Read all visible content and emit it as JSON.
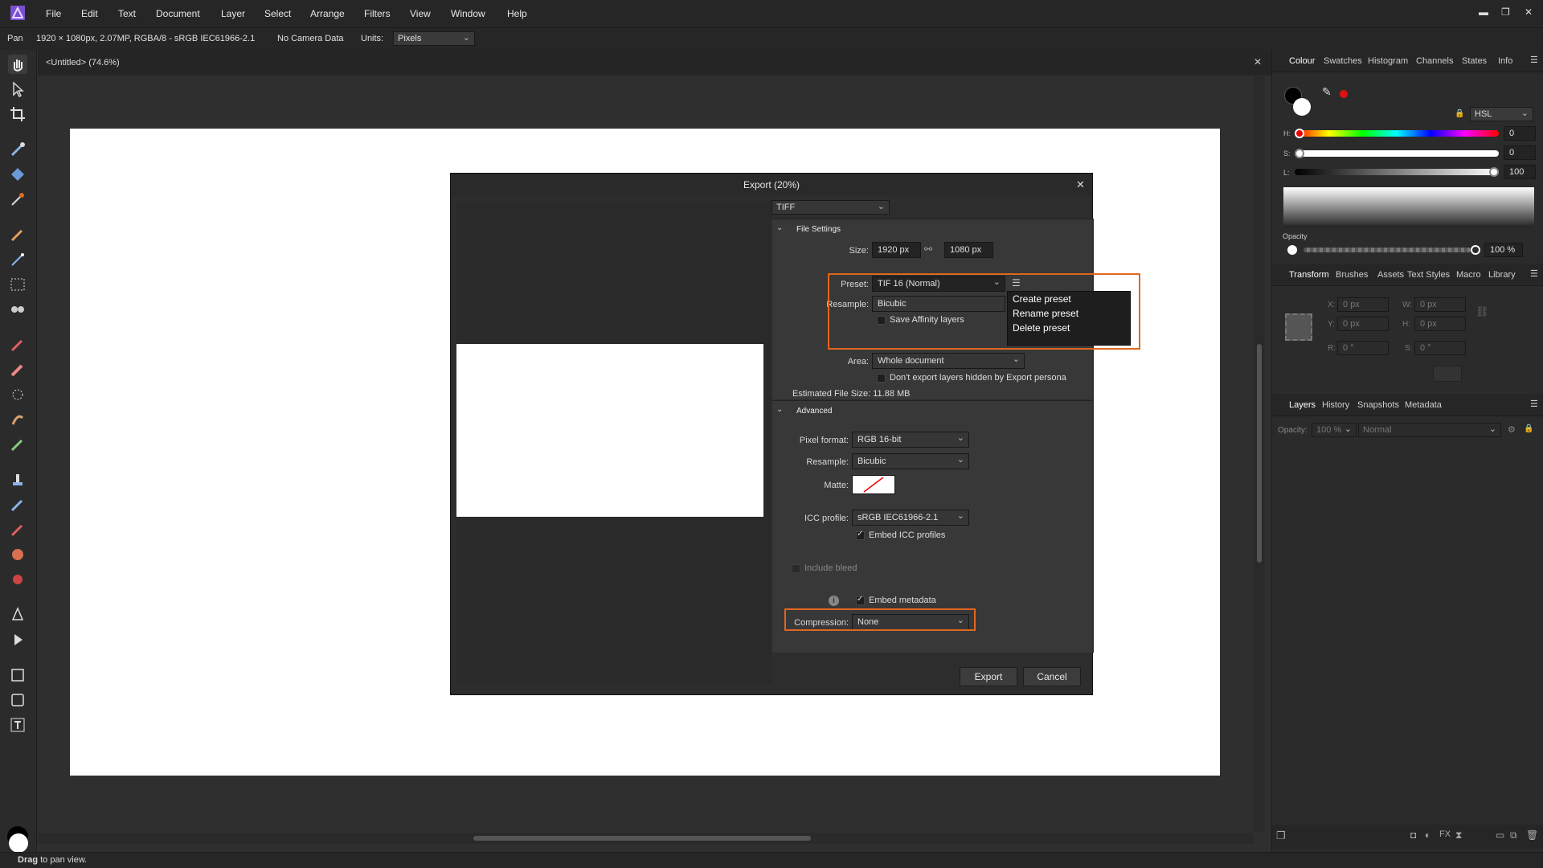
{
  "menubar": {
    "items": [
      "File",
      "Edit",
      "Text",
      "Document",
      "Layer",
      "Select",
      "Arrange",
      "Filters",
      "View",
      "Window",
      "Help"
    ]
  },
  "context": {
    "tool": "Pan",
    "doc_info": "1920 × 1080px, 2.07MP, RGBA/8 - sRGB IEC61966-2.1",
    "camera": "No Camera Data",
    "units_label": "Units:",
    "units_value": "Pixels"
  },
  "document": {
    "tab_title": "<Untitled> (74.6%)"
  },
  "status": {
    "bold": "Drag",
    "rest": " to pan view."
  },
  "colour_panel": {
    "tabs": [
      "Colour",
      "Swatches",
      "Histogram",
      "Channels",
      "States",
      "Info"
    ],
    "mode": "HSL",
    "h_label": "H:",
    "h_value": "0",
    "s_label": "S:",
    "s_value": "0",
    "l_label": "L:",
    "l_value": "100",
    "opacity_label": "Opacity",
    "opacity_value": "100 %"
  },
  "transform_panel": {
    "tabs": [
      "Transform",
      "Brushes",
      "Assets",
      "Text Styles",
      "Macro",
      "Library"
    ],
    "x_label": "X:",
    "x_value": "0 px",
    "y_label": "Y:",
    "y_value": "0 px",
    "w_label": "W:",
    "w_value": "0 px",
    "h_label": "H:",
    "h_value": "0 px",
    "r_label": "R:",
    "r_value": "0 °",
    "s_label": "S:",
    "s_value": "0 °"
  },
  "layers_panel": {
    "tabs": [
      "Layers",
      "History",
      "Snapshots",
      "Metadata"
    ],
    "opacity_label": "Opacity:",
    "opacity_value": "100 %",
    "blend": "Normal"
  },
  "dialog": {
    "title": "Export (20%)",
    "format": "TIFF",
    "file_settings": "File Settings",
    "size_label": "Size:",
    "width": "1920 px",
    "height": "1080 px",
    "preset_label": "Preset:",
    "preset_value": "TIF 16 (Normal)",
    "resample_label": "Resample:",
    "resample_value": "Bicubic",
    "save_layers": "Save Affinity layers",
    "area_label": "Area:",
    "area_value": "Whole document",
    "dont_export": "Don't export layers hidden by Export persona",
    "est_size": "Estimated File Size: 11.88 MB",
    "advanced": "Advanced",
    "pixel_format_label": "Pixel format:",
    "pixel_format_value": "RGB 16-bit",
    "adv_resample_label": "Resample:",
    "adv_resample_value": "Bicubic",
    "matte_label": "Matte:",
    "icc_label": "ICC profile:",
    "icc_value": "sRGB IEC61966-2.1",
    "embed_icc": "Embed ICC profiles",
    "include_bleed": "Include bleed",
    "embed_metadata": "Embed metadata",
    "compression_label": "Compression:",
    "compression_value": "None",
    "export_btn": "Export",
    "cancel_btn": "Cancel",
    "preset_menu": [
      "Create preset",
      "Rename preset",
      "Delete preset"
    ]
  },
  "colors": {
    "accent": "#e0661f",
    "bg": "#2f2f2f",
    "panel": "#262626"
  }
}
